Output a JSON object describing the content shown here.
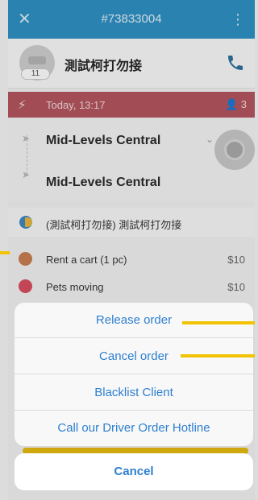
{
  "header": {
    "order_id": "#73833004",
    "close_icon": "close-icon",
    "more_icon": "more-vertical-icon"
  },
  "client": {
    "name": "測試柯打勿接",
    "badge_count": "11",
    "phone_icon": "phone-icon"
  },
  "schedule": {
    "time": "Today, 13:17",
    "passengers": "3",
    "bolt_icon": "bolt-icon",
    "person_icon": "person-icon"
  },
  "route": {
    "from": "Mid-Levels Central",
    "to": "Mid-Levels Central"
  },
  "note": {
    "text": "(測試柯打勿接) 測試柯打勿接"
  },
  "services": [
    {
      "label": "Rent a cart (1 pc)",
      "price": "$10"
    },
    {
      "label": "Pets moving",
      "price": "$10"
    }
  ],
  "action_sheet": {
    "items": [
      "Release order",
      "Cancel order",
      "Blacklist Client",
      "Call our Driver Order Hotline"
    ],
    "cancel": "Cancel"
  },
  "colors": {
    "header": "#2a8fc3",
    "date_bar": "#b3525d",
    "action_text": "#2f7fd0",
    "annotation": "#f2c300"
  }
}
